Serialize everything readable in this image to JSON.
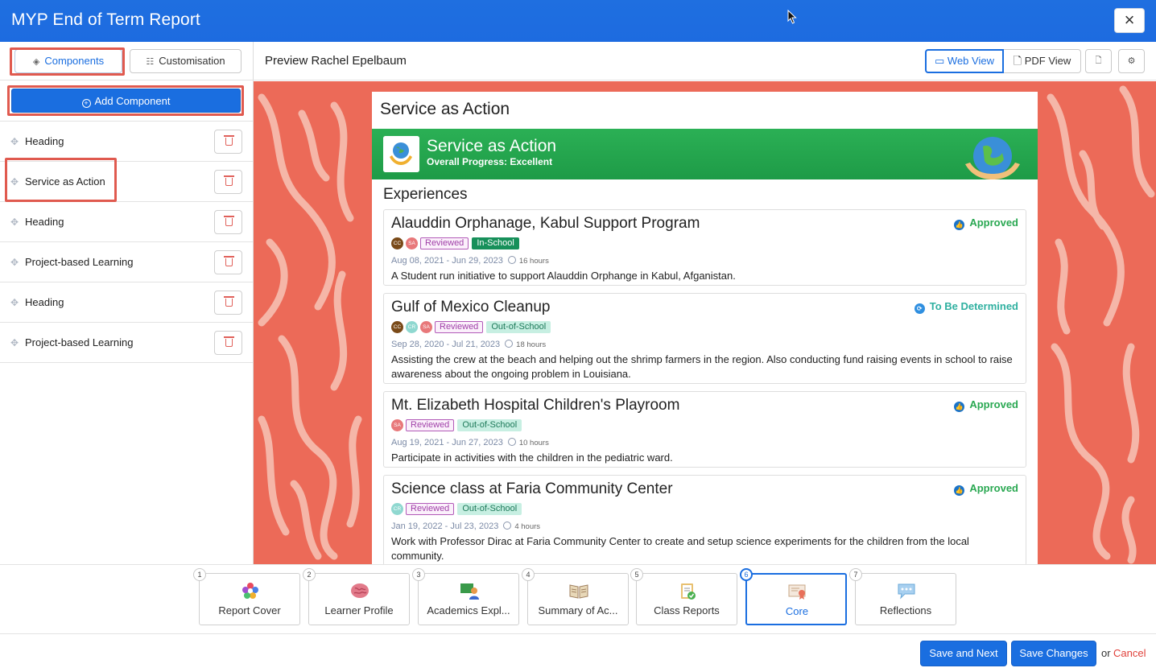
{
  "window": {
    "title": "MYP End of Term Report",
    "close_label": "×"
  },
  "sidebar": {
    "tabs": [
      {
        "label": "Components"
      },
      {
        "label": "Customisation"
      }
    ],
    "add_label": "Add Component",
    "items": [
      {
        "label": "Heading"
      },
      {
        "label": "Service as Action"
      },
      {
        "label": "Heading"
      },
      {
        "label": "Project-based Learning"
      },
      {
        "label": "Heading"
      },
      {
        "label": "Project-based Learning"
      }
    ]
  },
  "preview": {
    "title": "Preview Rachel Epelbaum",
    "web_view_label": "Web View",
    "pdf_view_label": "PDF View",
    "section_title": "Service as Action",
    "banner_title": "Service as Action",
    "banner_subtitle": "Overall Progress: Excellent",
    "experiences_heading": "Experiences",
    "cards": [
      {
        "title": "Alauddin Orphanage, Kabul Support Program",
        "status": "Approved",
        "avatars": [
          "CC",
          "SA"
        ],
        "tags": [
          "Reviewed",
          "In-School"
        ],
        "dates": "Aug 08, 2021 - Jun 29, 2023",
        "hours": "16 hours",
        "description": "A Student run initiative to support Alauddin Orphange in Kabul, Afganistan."
      },
      {
        "title": "Gulf of Mexico Cleanup",
        "status": "To Be Determined",
        "avatars": [
          "CC",
          "CR",
          "SA"
        ],
        "tags": [
          "Reviewed",
          "Out-of-School"
        ],
        "dates": "Sep 28, 2020 - Jul 21, 2023",
        "hours": "18 hours",
        "description": "Assisting the crew at the beach and helping out the shrimp farmers in the region. Also conducting fund raising events in school to raise awareness about the ongoing problem in Louisiana."
      },
      {
        "title": "Mt. Elizabeth Hospital Children's Playroom",
        "status": "Approved",
        "avatars": [
          "SA"
        ],
        "tags": [
          "Reviewed",
          "Out-of-School"
        ],
        "dates": "Aug 19, 2021 - Jun 27, 2023",
        "hours": "10 hours",
        "description": "Participate in activities with the children in the pediatric ward."
      },
      {
        "title": "Science class at Faria Community Center",
        "status": "Approved",
        "avatars": [
          "CR"
        ],
        "tags": [
          "Reviewed",
          "Out-of-School"
        ],
        "dates": "Jan 19, 2022 - Jul 23, 2023",
        "hours": "4 hours",
        "description": "Work with Professor Dirac at Faria Community Center to create and setup science experiments for the children from the local community."
      }
    ]
  },
  "steps": [
    {
      "num": "1",
      "label": "Report Cover"
    },
    {
      "num": "2",
      "label": "Learner Profile"
    },
    {
      "num": "3",
      "label": "Academics Expl..."
    },
    {
      "num": "4",
      "label": "Summary of Ac..."
    },
    {
      "num": "5",
      "label": "Class Reports"
    },
    {
      "num": "6",
      "label": "Core"
    },
    {
      "num": "7",
      "label": "Reflections"
    }
  ],
  "active_step": "6",
  "footer": {
    "save_next_label": "Save and Next",
    "save_label": "Save Changes",
    "or_text": "or",
    "cancel_label": "Cancel"
  },
  "colors": {
    "title_bar": "#1d6be0",
    "accent": "#1a6ee0",
    "banner": "#23a84f",
    "preview_bg": "#ec6a58",
    "highlight": "#e05a4f",
    "approved": "#2aa852"
  }
}
